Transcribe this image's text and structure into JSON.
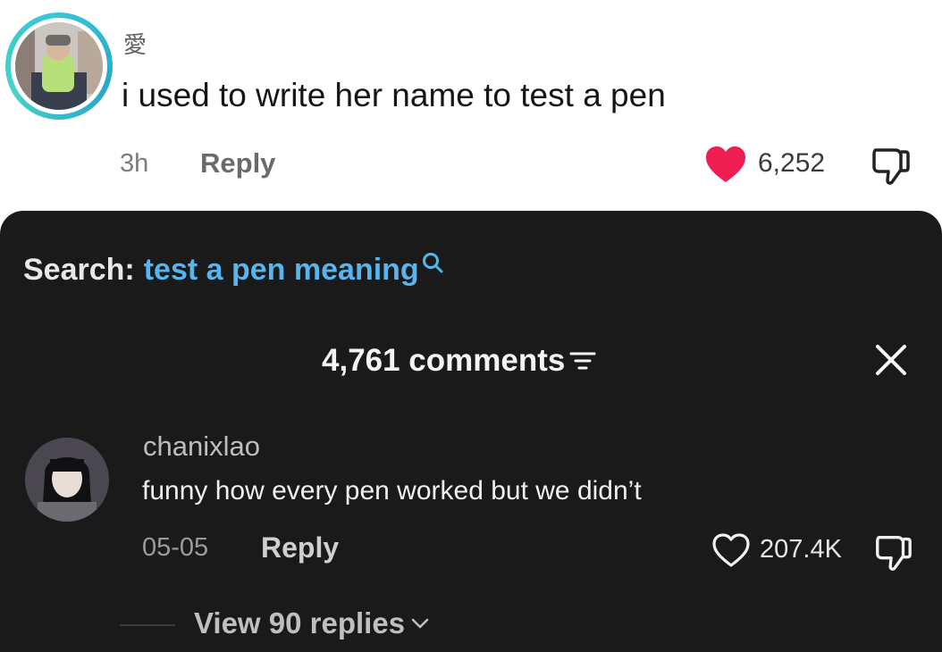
{
  "top_comment": {
    "username": "愛",
    "text": "i used to write her name to test a pen",
    "time": "3h",
    "reply_label": "Reply",
    "likes": "6,252",
    "liked": true,
    "ring_color": "#36c5d6",
    "heart_color": "#ee1d52"
  },
  "sheet": {
    "search_prefix": "Search:",
    "search_term": "test a pen meaning",
    "search_icon": "search-icon",
    "comments_count": "4,761 comments",
    "sort_icon": "sort-icon",
    "close_icon": "close-icon",
    "background": "#1a1a1a",
    "search_term_color": "#56b4ee"
  },
  "reply_comment": {
    "username": "chanixlao",
    "text": "funny how every pen worked but we didn’t",
    "date": "05-05",
    "reply_label": "Reply",
    "likes": "207.4K",
    "liked": false,
    "view_replies": "View 90 replies"
  }
}
